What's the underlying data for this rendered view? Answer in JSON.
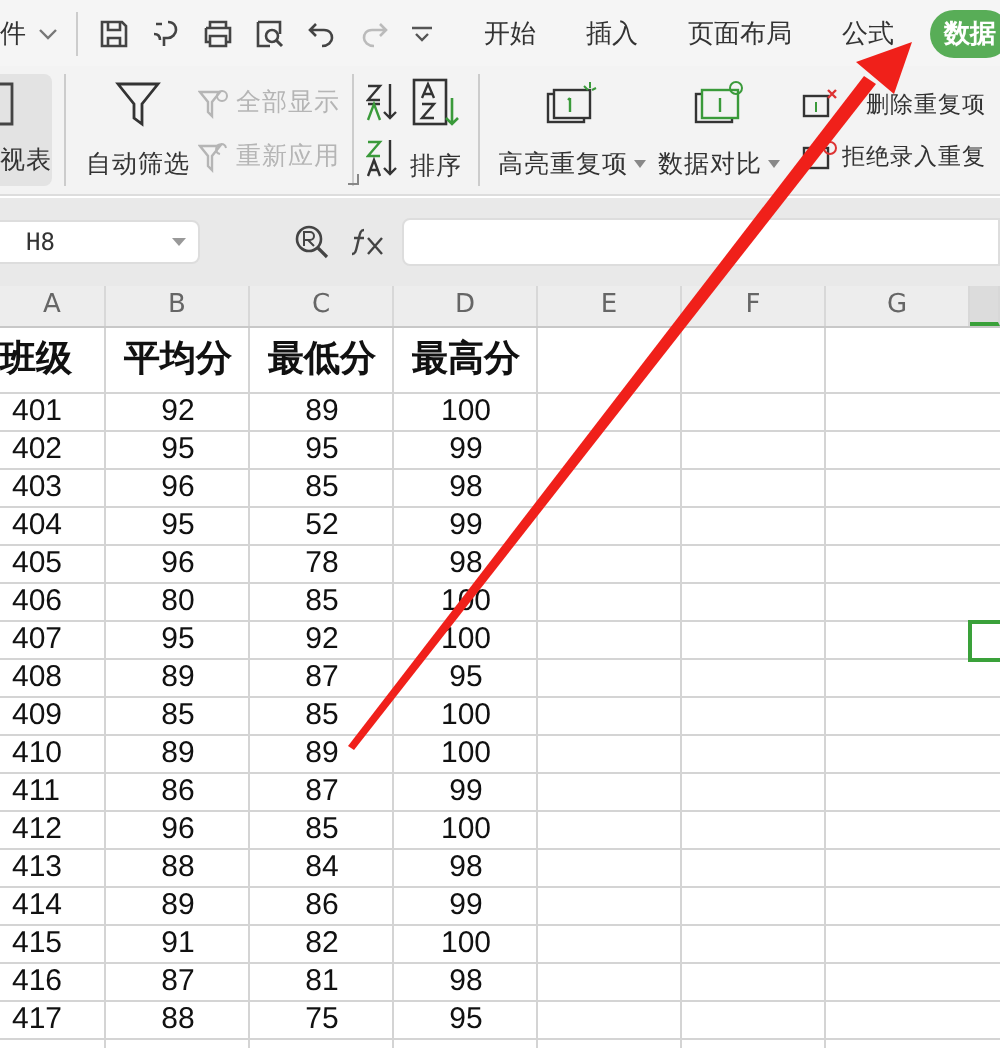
{
  "title_bar": {
    "menu_label": "件",
    "tabs": [
      {
        "label": "开始",
        "selected": false
      },
      {
        "label": "插入",
        "selected": false
      },
      {
        "label": "页面布局",
        "selected": false
      },
      {
        "label": "公式",
        "selected": false
      },
      {
        "label": "数据",
        "selected": true
      }
    ]
  },
  "ribbon": {
    "pivot": {
      "label": "视表",
      "selected": true
    },
    "auto_filter": {
      "label": "自动筛选"
    },
    "show_all": {
      "label": "全部显示",
      "disabled": true
    },
    "reapply": {
      "label": "重新应用",
      "disabled": true
    },
    "sort": {
      "label": "排序"
    },
    "highlight_duplicates": {
      "label": "高亮重复项"
    },
    "compare": {
      "label": "数据对比"
    },
    "remove_duplicates": {
      "label": "删除重复项"
    },
    "reject_duplicates": {
      "label": "拒绝录入重复"
    }
  },
  "formula_bar": {
    "cell_ref": "H8"
  },
  "columns": [
    {
      "label": "A",
      "selected": false
    },
    {
      "label": "B",
      "selected": false
    },
    {
      "label": "C",
      "selected": false
    },
    {
      "label": "D",
      "selected": false
    },
    {
      "label": "E",
      "selected": false
    },
    {
      "label": "F",
      "selected": false
    },
    {
      "label": "G",
      "selected": false
    },
    {
      "selected": true
    }
  ],
  "rows": [
    {
      "kind": "header",
      "selected": false,
      "cells": [
        "班级",
        "平均分",
        "最低分",
        "最高分"
      ]
    },
    {
      "kind": "data",
      "selected": false,
      "cells": [
        "401",
        "92",
        "89",
        "100"
      ]
    },
    {
      "kind": "data",
      "selected": false,
      "cells": [
        "402",
        "95",
        "95",
        "99"
      ]
    },
    {
      "kind": "data",
      "selected": false,
      "cells": [
        "403",
        "96",
        "85",
        "98"
      ]
    },
    {
      "kind": "data",
      "selected": false,
      "cells": [
        "404",
        "95",
        "52",
        "99"
      ]
    },
    {
      "kind": "data",
      "selected": false,
      "cells": [
        "405",
        "96",
        "78",
        "98"
      ]
    },
    {
      "kind": "data",
      "selected": false,
      "cells": [
        "406",
        "80",
        "85",
        "100"
      ]
    },
    {
      "kind": "data",
      "selected": true,
      "cells": [
        "407",
        "95",
        "92",
        "100"
      ]
    },
    {
      "kind": "data",
      "selected": false,
      "cells": [
        "408",
        "89",
        "87",
        "95"
      ]
    },
    {
      "kind": "data",
      "selected": false,
      "cells": [
        "409",
        "85",
        "85",
        "100"
      ]
    },
    {
      "kind": "data",
      "selected": false,
      "cells": [
        "410",
        "89",
        "89",
        "100"
      ]
    },
    {
      "kind": "data",
      "selected": false,
      "cells": [
        "411",
        "86",
        "87",
        "99"
      ]
    },
    {
      "kind": "data",
      "selected": false,
      "cells": [
        "412",
        "96",
        "85",
        "100"
      ]
    },
    {
      "kind": "data",
      "selected": false,
      "cells": [
        "413",
        "88",
        "84",
        "98"
      ]
    },
    {
      "kind": "data",
      "selected": false,
      "cells": [
        "414",
        "89",
        "86",
        "99"
      ]
    },
    {
      "kind": "data",
      "selected": false,
      "cells": [
        "415",
        "91",
        "82",
        "100"
      ]
    },
    {
      "kind": "data",
      "selected": false,
      "cells": [
        "416",
        "87",
        "81",
        "98"
      ]
    },
    {
      "kind": "data",
      "selected": false,
      "cells": [
        "417",
        "88",
        "75",
        "95"
      ]
    }
  ]
}
